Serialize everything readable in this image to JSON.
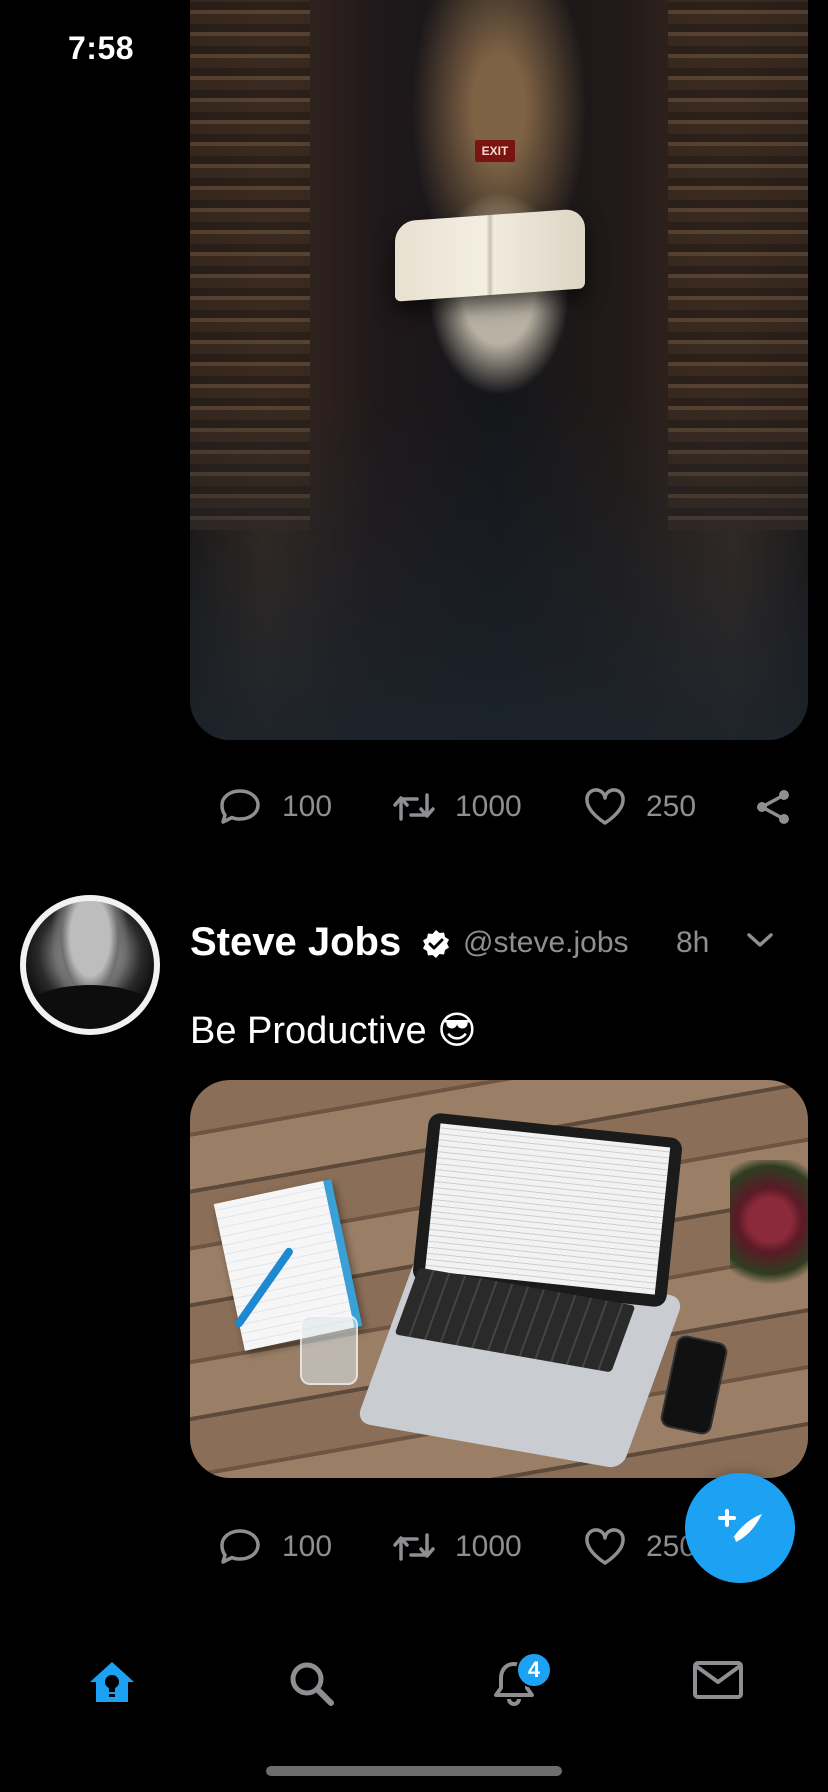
{
  "status_bar": {
    "time": "7:58"
  },
  "post1": {
    "media_alt": "Library with floating open book",
    "exit_sign": "EXIT",
    "actions": {
      "comments": "100",
      "retweets": "1000",
      "likes": "250"
    }
  },
  "post2": {
    "name": "Steve Jobs",
    "handle": "@steve.jobs",
    "time": "8h",
    "text": "Be Productive 😎",
    "media_alt": "Desk with laptop, notebook and phone",
    "actions": {
      "comments": "100",
      "retweets": "1000",
      "likes": "250"
    }
  },
  "nav": {
    "notifications_badge": "4"
  },
  "colors": {
    "accent": "#1da1f2",
    "muted": "#8e8e93",
    "background": "#000000"
  }
}
